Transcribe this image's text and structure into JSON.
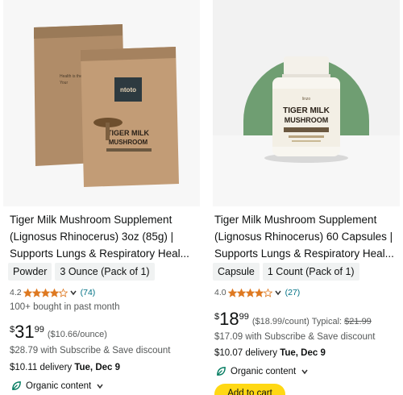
{
  "products": [
    {
      "title": "Tiger Milk Mushroom Supplement (Lignosus Rhinocerus) 3oz (85g) | Supports Lungs & Respiratory Heal...",
      "image_brand": "ntoto",
      "image_product": "TIGER MILK MUSHROOM",
      "variants": [
        "Powder",
        "3 Ounce (Pack of 1)"
      ],
      "rating": "4.2",
      "rating_value": 4.2,
      "review_count": "(74)",
      "bought": "100+ bought in past month",
      "price_currency": "$",
      "price_whole": "31",
      "price_fraction": "99",
      "price_unit": "($10.66/ounce)",
      "subscribe_save": "$28.79 with Subscribe & Save discount",
      "delivery_prefix": "$10.11 delivery ",
      "delivery_date": "Tue, Dec 9",
      "organic_label": "Organic content"
    },
    {
      "title": "Tiger Milk Mushroom Supplement (Lignosus Rhinocerus) 60 Capsules | Supports Lungs & Respiratory Heal...",
      "image_brand": "linzo",
      "image_product": "TIGER MILK MUSHROOM",
      "variants": [
        "Capsule",
        "1 Count (Pack of 1)"
      ],
      "rating": "4.0",
      "rating_value": 4.0,
      "review_count": "(27)",
      "price_currency": "$",
      "price_whole": "18",
      "price_fraction": "99",
      "price_unit": "($18.99/count)",
      "typical_label": "Typical:",
      "typical_price": "$21.99",
      "subscribe_save": "$17.09 with Subscribe & Save discount",
      "delivery_prefix": "$10.07 delivery ",
      "delivery_date": "Tue, Dec 9",
      "organic_label": "Organic content",
      "add_to_cart": "Add to cart"
    }
  ],
  "colors": {
    "star": "#de7921",
    "link": "#007185",
    "organic_green": "#067d62",
    "cart_button": "#ffd814",
    "chip_bg": "#f0f2f2"
  }
}
